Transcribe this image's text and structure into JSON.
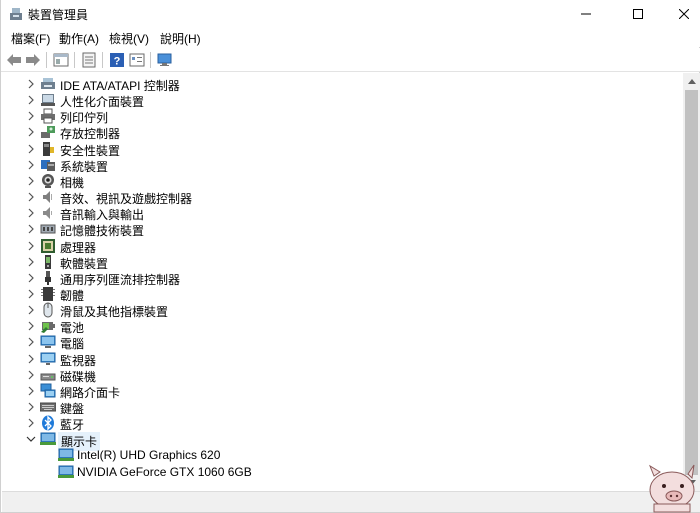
{
  "window": {
    "title": "裝置管理員",
    "controls": {
      "minimize": "—",
      "maximize": "☐",
      "close": "✕"
    }
  },
  "menu": [
    "檔案(F)",
    "動作(A)",
    "檢視(V)",
    "說明(H)"
  ],
  "toolbar": {
    "buttons": [
      "back-arrow-icon",
      "forward-arrow-icon",
      "properties-icon",
      "update-driver-icon",
      "help-icon",
      "show-details-icon",
      "scan-hardware-icon"
    ]
  },
  "tree": {
    "categories": [
      {
        "label": "IDE ATA/ATAPI 控制器",
        "icon": "ide-controller-icon",
        "expanded": false
      },
      {
        "label": "人性化介面裝置",
        "icon": "hid-icon",
        "expanded": false
      },
      {
        "label": "列印佇列",
        "icon": "printer-icon",
        "expanded": false
      },
      {
        "label": "存放控制器",
        "icon": "storage-controller-icon",
        "expanded": false
      },
      {
        "label": "安全性裝置",
        "icon": "security-device-icon",
        "expanded": false
      },
      {
        "label": "系統裝置",
        "icon": "system-device-icon",
        "expanded": false
      },
      {
        "label": "相機",
        "icon": "camera-icon",
        "expanded": false
      },
      {
        "label": "音效、視訊及遊戲控制器",
        "icon": "sound-icon",
        "expanded": false
      },
      {
        "label": "音訊輸入與輸出",
        "icon": "audio-io-icon",
        "expanded": false
      },
      {
        "label": "記憶體技術裝置",
        "icon": "memory-tech-icon",
        "expanded": false
      },
      {
        "label": "處理器",
        "icon": "processor-icon",
        "expanded": false
      },
      {
        "label": "軟體裝置",
        "icon": "software-device-icon",
        "expanded": false
      },
      {
        "label": "通用序列匯流排控制器",
        "icon": "usb-icon",
        "expanded": false
      },
      {
        "label": "韌體",
        "icon": "firmware-icon",
        "expanded": false
      },
      {
        "label": "滑鼠及其他指標裝置",
        "icon": "mouse-icon",
        "expanded": false
      },
      {
        "label": "電池",
        "icon": "battery-icon",
        "expanded": false
      },
      {
        "label": "電腦",
        "icon": "computer-icon",
        "expanded": false
      },
      {
        "label": "監視器",
        "icon": "monitor-icon",
        "expanded": false
      },
      {
        "label": "磁碟機",
        "icon": "disk-drive-icon",
        "expanded": false
      },
      {
        "label": "網路介面卡",
        "icon": "network-adapter-icon",
        "expanded": false
      },
      {
        "label": "鍵盤",
        "icon": "keyboard-icon",
        "expanded": false
      },
      {
        "label": "藍牙",
        "icon": "bluetooth-icon",
        "expanded": false
      },
      {
        "label": "顯示卡",
        "icon": "display-adapter-icon",
        "expanded": true,
        "selected": true
      }
    ],
    "display_adapters": [
      {
        "label": "Intel(R) UHD Graphics 620",
        "icon": "display-adapter-icon"
      },
      {
        "label": "NVIDIA GeForce GTX 1060 6GB",
        "icon": "display-adapter-icon"
      }
    ]
  },
  "colors": {
    "selection": "#e5f1fb",
    "scroll_track": "#f0f0f0",
    "scroll_thumb": "#c1c1c1",
    "monitor_blue": "#3b8fd6",
    "bluetooth_blue": "#1f7ad9"
  }
}
